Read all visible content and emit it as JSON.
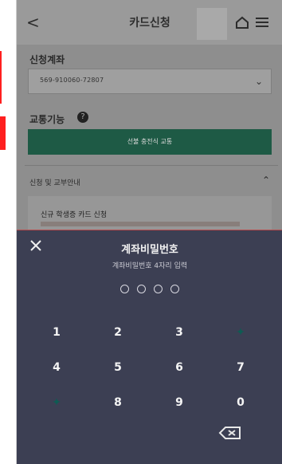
{
  "header": {
    "back": "<",
    "title": "카드신청"
  },
  "account": {
    "label": "신청계좌",
    "value": "569-910060-72807"
  },
  "transport": {
    "label": "교통기능",
    "button": "선불 충전식 교통"
  },
  "section": {
    "title": "신청 및 교부안내",
    "panel_title": "신규 학생증 카드 신청"
  },
  "keypad_sheet": {
    "title": "계좌비밀번호",
    "subtitle": "계좌비밀번호 4자리 입력",
    "keys": [
      "1",
      "2",
      "3",
      "4",
      "5",
      "6",
      "7",
      "8",
      "9",
      "0"
    ]
  },
  "colors": {
    "green_button": "#1e5a45",
    "sheet_bg": "#3c3f53",
    "red_marker": "#ff1f1f"
  }
}
